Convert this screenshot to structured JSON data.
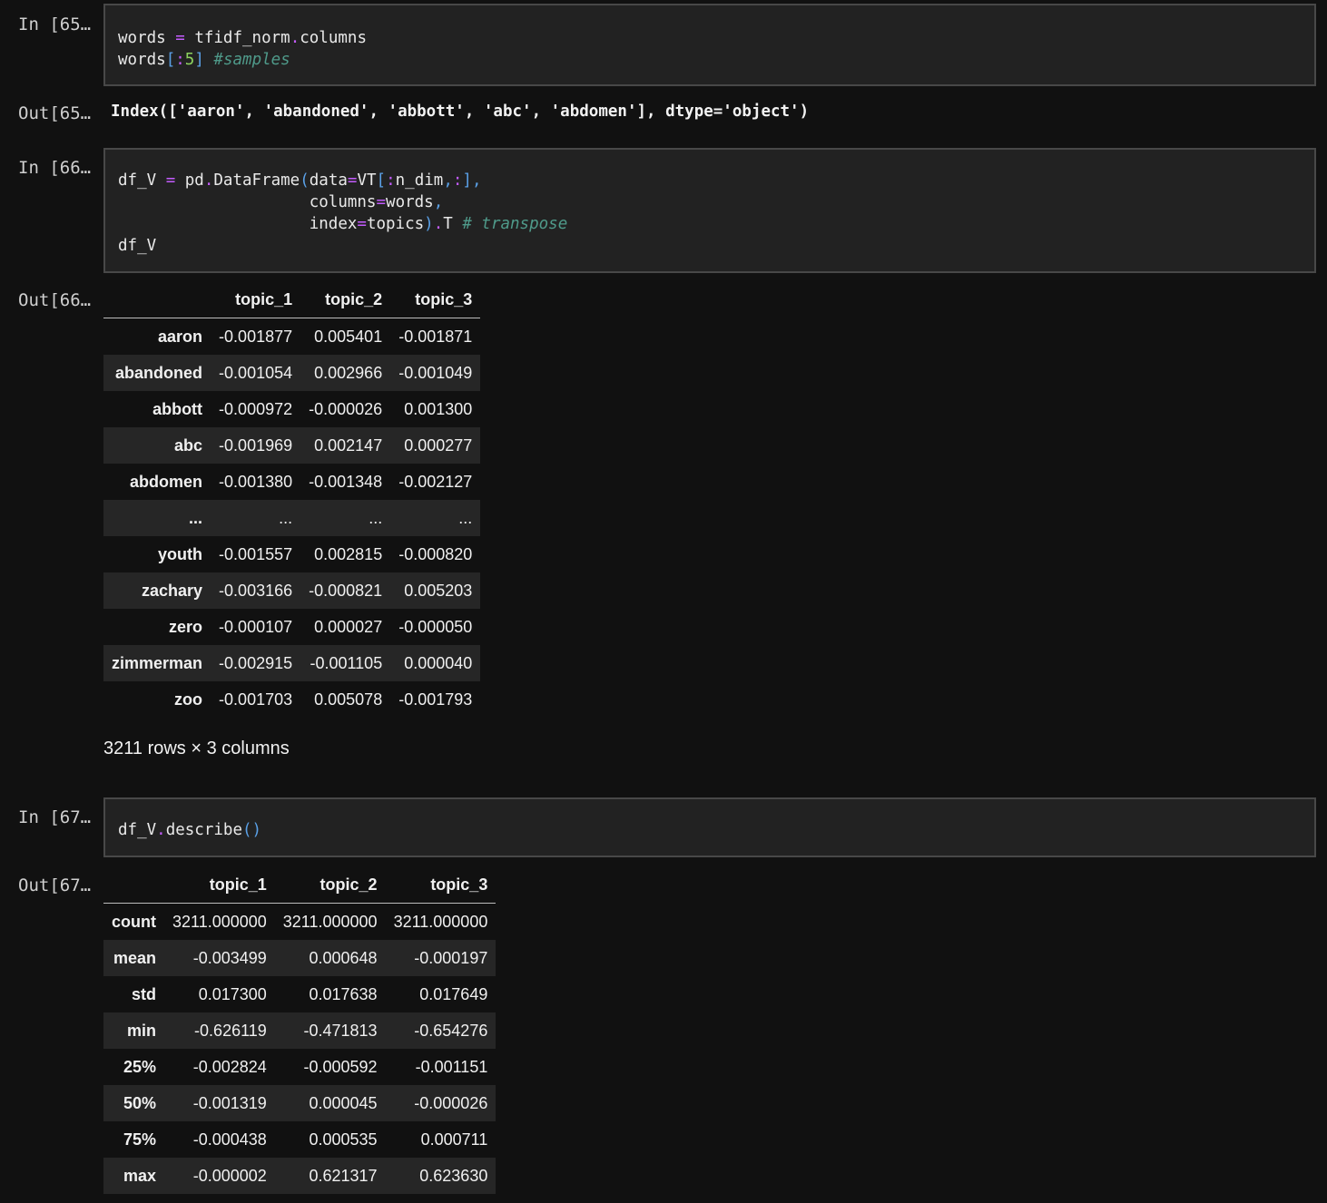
{
  "cells": {
    "in65": {
      "prompt": "In [65…",
      "code_lines": [
        "words = tfidf_norm.columns",
        "words[:5] #samples"
      ]
    },
    "out65": {
      "prompt": "Out[65…",
      "text": "Index(['aaron', 'abandoned', 'abbott', 'abc', 'abdomen'], dtype='object')"
    },
    "in66": {
      "prompt": "In [66…",
      "code_lines": [
        "df_V = pd.DataFrame(data=VT[:n_dim,:],",
        "                    columns=words,",
        "                    index=topics).T # transpose",
        "df_V"
      ]
    },
    "out66": {
      "prompt": "Out[66…",
      "columns": [
        "topic_1",
        "topic_2",
        "topic_3"
      ],
      "rows": [
        {
          "index": "aaron",
          "values": [
            "-0.001877",
            "0.005401",
            "-0.001871"
          ]
        },
        {
          "index": "abandoned",
          "values": [
            "-0.001054",
            "0.002966",
            "-0.001049"
          ]
        },
        {
          "index": "abbott",
          "values": [
            "-0.000972",
            "-0.000026",
            "0.001300"
          ]
        },
        {
          "index": "abc",
          "values": [
            "-0.001969",
            "0.002147",
            "0.000277"
          ]
        },
        {
          "index": "abdomen",
          "values": [
            "-0.001380",
            "-0.001348",
            "-0.002127"
          ]
        },
        {
          "index": "...",
          "values": [
            "...",
            "...",
            "..."
          ]
        },
        {
          "index": "youth",
          "values": [
            "-0.001557",
            "0.002815",
            "-0.000820"
          ]
        },
        {
          "index": "zachary",
          "values": [
            "-0.003166",
            "-0.000821",
            "0.005203"
          ]
        },
        {
          "index": "zero",
          "values": [
            "-0.000107",
            "0.000027",
            "-0.000050"
          ]
        },
        {
          "index": "zimmerman",
          "values": [
            "-0.002915",
            "-0.001105",
            "0.000040"
          ]
        },
        {
          "index": "zoo",
          "values": [
            "-0.001703",
            "0.005078",
            "-0.001793"
          ]
        }
      ],
      "shape_text": "3211 rows × 3 columns"
    },
    "in67": {
      "prompt": "In [67…",
      "code_lines": [
        "df_V.describe()"
      ]
    },
    "out67": {
      "prompt": "Out[67…",
      "columns": [
        "topic_1",
        "topic_2",
        "topic_3"
      ],
      "rows": [
        {
          "index": "count",
          "values": [
            "3211.000000",
            "3211.000000",
            "3211.000000"
          ]
        },
        {
          "index": "mean",
          "values": [
            "-0.003499",
            "0.000648",
            "-0.000197"
          ]
        },
        {
          "index": "std",
          "values": [
            "0.017300",
            "0.017638",
            "0.017649"
          ]
        },
        {
          "index": "min",
          "values": [
            "-0.626119",
            "-0.471813",
            "-0.654276"
          ]
        },
        {
          "index": "25%",
          "values": [
            "-0.002824",
            "-0.000592",
            "-0.001151"
          ]
        },
        {
          "index": "50%",
          "values": [
            "-0.001319",
            "0.000045",
            "-0.000026"
          ]
        },
        {
          "index": "75%",
          "values": [
            "-0.000438",
            "0.000535",
            "0.000711"
          ]
        },
        {
          "index": "max",
          "values": [
            "-0.000002",
            "0.621317",
            "0.623630"
          ]
        }
      ]
    }
  },
  "colors": {
    "background": "#111111",
    "cell_background": "#222222",
    "cell_border": "#484848",
    "operator": "#c45cff",
    "bracket": "#5aa0e6",
    "number": "#8dd35f",
    "comment": "#4f9a8a"
  }
}
